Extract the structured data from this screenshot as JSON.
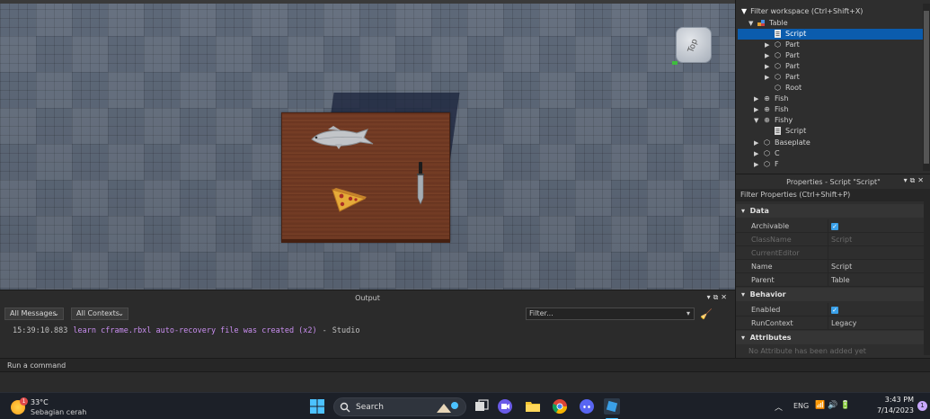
{
  "explorer": {
    "filter_label": "Filter workspace (Ctrl+Shift+X)",
    "items": [
      {
        "label": "Table",
        "icon": "model-icon",
        "level": 1,
        "expanded": true
      },
      {
        "label": "Script",
        "icon": "script-icon",
        "level": 2,
        "selected": true
      },
      {
        "label": "Part",
        "icon": "part-icon",
        "level": 2
      },
      {
        "label": "Part",
        "icon": "part-icon",
        "level": 2
      },
      {
        "label": "Part",
        "icon": "part-icon",
        "level": 2
      },
      {
        "label": "Part",
        "icon": "part-icon",
        "level": 2
      },
      {
        "label": "Root",
        "icon": "part-icon",
        "level": 2
      },
      {
        "label": "Fish",
        "icon": "mesh-icon",
        "level": 1
      },
      {
        "label": "Fish",
        "icon": "mesh-icon",
        "level": 1
      },
      {
        "label": "Fishy",
        "icon": "mesh-icon",
        "level": 1,
        "expanded": true
      },
      {
        "label": "Script",
        "icon": "script-icon",
        "level": 2
      },
      {
        "label": "Baseplate",
        "icon": "part-icon",
        "level": 1
      },
      {
        "label": "C",
        "icon": "part-icon",
        "level": 1
      },
      {
        "label": "F",
        "icon": "part-icon",
        "level": 1
      }
    ]
  },
  "properties": {
    "title": "Properties - Script \"Script\"",
    "filter_label": "Filter Properties (Ctrl+Shift+P)",
    "sections": {
      "data": "Data",
      "behavior": "Behavior",
      "attributes": "Attributes"
    },
    "rows": {
      "archivable": {
        "name": "Archivable",
        "checked": true
      },
      "classname": {
        "name": "ClassName",
        "value": "Script"
      },
      "currenteditor": {
        "name": "CurrentEditor",
        "value": ""
      },
      "name": {
        "name": "Name",
        "value": "Script"
      },
      "parent": {
        "name": "Parent",
        "value": "Table"
      },
      "enabled": {
        "name": "Enabled",
        "checked": true
      },
      "runcontext": {
        "name": "RunContext",
        "value": "Legacy"
      }
    },
    "attributes_note": "No Attribute has been added yet"
  },
  "viewport": {
    "view_cube_label": "Top"
  },
  "output": {
    "title": "Output",
    "messages_filter": "All Messages",
    "contexts_filter": "All Contexts",
    "filter_placeholder": "Filter...",
    "log": {
      "timestamp": "15:39:10.883",
      "message": "learn cframe.rbxl auto-recovery file was created (x2)",
      "separator": "-",
      "source": "Studio"
    }
  },
  "command_bar": {
    "placeholder": "Run a command"
  },
  "taskbar": {
    "weather_temp": "33°C",
    "weather_desc": "Sebagian cerah",
    "weather_badge": "1",
    "search_label": "Search",
    "language": "ENG",
    "time": "3:43 PM",
    "date": "7/14/2023",
    "notification_count": "1"
  },
  "colors": {
    "selection": "#0b5cad",
    "checkbox": "#3aa0e8",
    "log_message": "#c98ef0"
  }
}
